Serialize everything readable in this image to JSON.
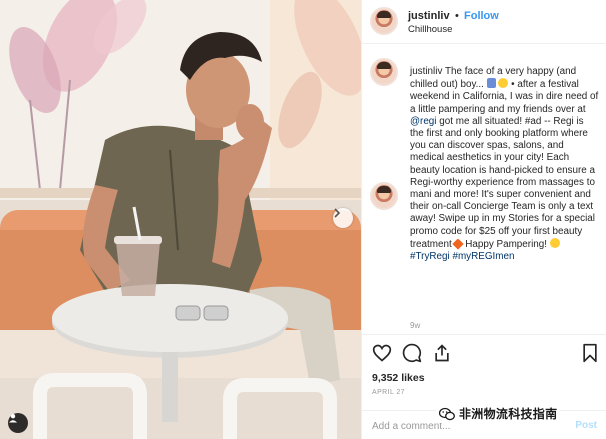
{
  "post": {
    "username": "justinliv",
    "separator": "•",
    "follow_label": "Follow",
    "location": "Chillhouse"
  },
  "caption": {
    "username": "justinliv",
    "part1": " The face of a very happy (and chilled out) boy... ",
    "part2": " • after a festival weekend in California, I was in dire need of a little pampering and my friends over at ",
    "mention": "@regi",
    "part3": " got me all situated! #ad -- Regi is the first and only booking platform where you can discover spas, salons, and medical aesthetics in your city! Each beauty location is hand-picked to ensure a Regi-worthy experience from massages to mani and more! It's super convenient and their on-call Concierge Team is only a text away! Swipe up in my Stories for a special promo code for $25 off your first beauty treatment ",
    "part4": " Happy Pampering! ",
    "tag1": "#TryRegi",
    "tag2": "#myREGImen",
    "age": "9w"
  },
  "actions": {
    "likes": "9,352 likes",
    "date": "APRIL 27",
    "comment_placeholder": "Add a comment...",
    "post_label": "Post"
  },
  "icons": {
    "like": "heart-icon",
    "comment": "comment-bubble-icon",
    "share": "share-icon",
    "save": "bookmark-icon",
    "next": "chevron-right-icon",
    "tagged": "user-tag-icon"
  },
  "watermark": {
    "text": "非洲物流科技指南"
  },
  "colors": {
    "link": "#3897f0",
    "mention": "#003569",
    "muted": "#999999",
    "post_disabled": "#b2dffc"
  }
}
